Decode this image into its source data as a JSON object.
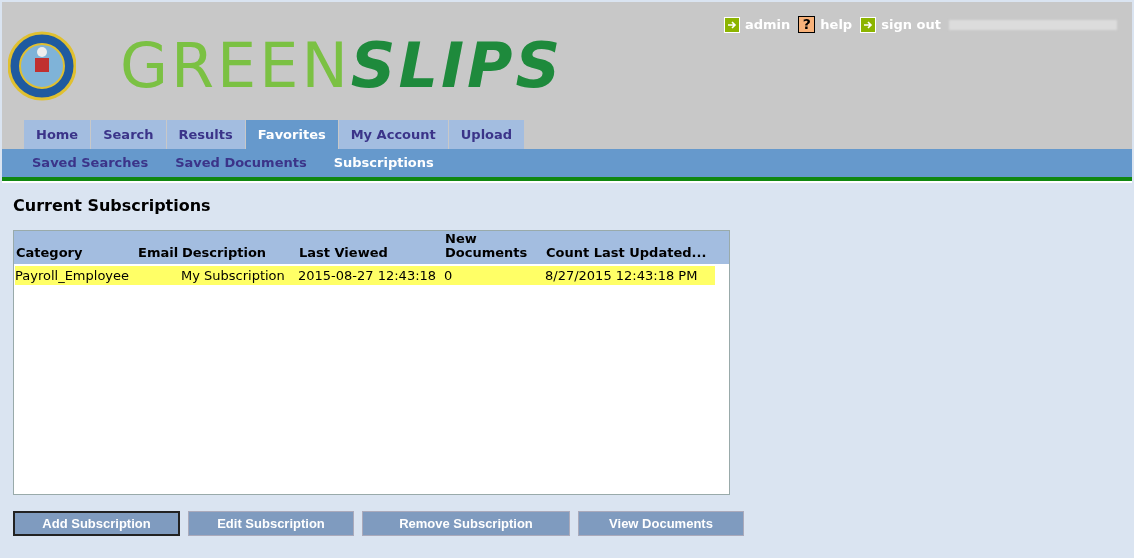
{
  "logo": {
    "brand_light": "GREEN",
    "brand_bold": "SLIPS"
  },
  "user_links": [
    {
      "label": "admin",
      "kind": "arrow"
    },
    {
      "label": "help",
      "kind": "question",
      "icon": "?"
    },
    {
      "label": "sign out",
      "kind": "arrow"
    }
  ],
  "tabs": [
    {
      "label": "Home",
      "selected": false
    },
    {
      "label": "Search",
      "selected": false
    },
    {
      "label": "Results",
      "selected": false
    },
    {
      "label": "Favorites",
      "selected": true
    },
    {
      "label": "My Account",
      "selected": false
    },
    {
      "label": "Upload",
      "selected": false
    }
  ],
  "subtabs": [
    {
      "label": "Saved Searches",
      "selected": false
    },
    {
      "label": "Saved Documents",
      "selected": false
    },
    {
      "label": "Subscriptions",
      "selected": true
    }
  ],
  "heading": "Current Subscriptions",
  "table": {
    "columns": [
      "Category",
      "Email",
      "Description",
      "Last Viewed",
      "New Documents",
      "Count Last Updated..."
    ],
    "rows": [
      {
        "selected": true,
        "cells": [
          "Payroll_Employee",
          "",
          "My Subscription",
          "2015-08-27 12:43:18",
          "0",
          "8/27/2015 12:43:18 PM"
        ]
      }
    ]
  },
  "buttons": [
    {
      "label": "Add Subscription",
      "focused": true
    },
    {
      "label": "Edit Subscription",
      "focused": false
    },
    {
      "label": "Remove Subscription",
      "focused": false
    },
    {
      "label": "View Documents",
      "focused": false
    }
  ]
}
